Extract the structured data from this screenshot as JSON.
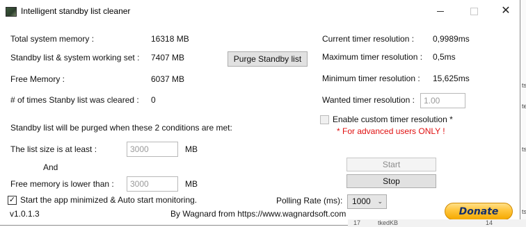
{
  "window": {
    "title": "Intelligent standby list cleaner"
  },
  "memory": {
    "total_label": "Total system memory :",
    "total_value": "16318 MB",
    "standby_label": "Standby list & system working set :",
    "standby_value": "7407 MB",
    "free_label": "Free Memory :",
    "free_value": "6037 MB",
    "cleared_label": "# of times Stanby list was cleared :",
    "cleared_value": "0",
    "purge_button": "Purge Standby list"
  },
  "timer": {
    "current_label": "Current timer resolution :",
    "current_value": "0,9989ms",
    "max_label": "Maximum timer resolution :",
    "max_value": "0,5ms",
    "min_label": "Minimum timer resolution :",
    "min_value": "15,625ms",
    "wanted_label": "Wanted timer resolution :",
    "wanted_value": "1.00",
    "custom_label": "Enable custom timer resolution *",
    "custom_checked": false,
    "advanced_warning": "* For advanced users ONLY !"
  },
  "conditions": {
    "heading": "Standby list will be purged when these 2 conditions are met:",
    "list_size_label": "The list size is at least :",
    "list_size_value": "3000",
    "list_size_unit": "MB",
    "and_label": "And",
    "free_mem_label": "Free memory is lower than :",
    "free_mem_value": "3000",
    "free_mem_unit": "MB"
  },
  "controls": {
    "start_button": "Start",
    "stop_button": "Stop",
    "autostart_label": "Start the app minimized & Auto start monitoring.",
    "autostart_checked": true,
    "polling_label": "Polling Rate (ms):",
    "polling_value": "1000"
  },
  "footer": {
    "version": "v1.0.1.3",
    "credit": "By Wagnard from https://www.wagnardsoft.com",
    "donate": "Donate"
  },
  "background": {
    "side_fragments": [
      "ts",
      "te",
      "ts",
      "ts"
    ],
    "bottom_fragments": [
      "17",
      "tkedKB",
      "14"
    ]
  }
}
